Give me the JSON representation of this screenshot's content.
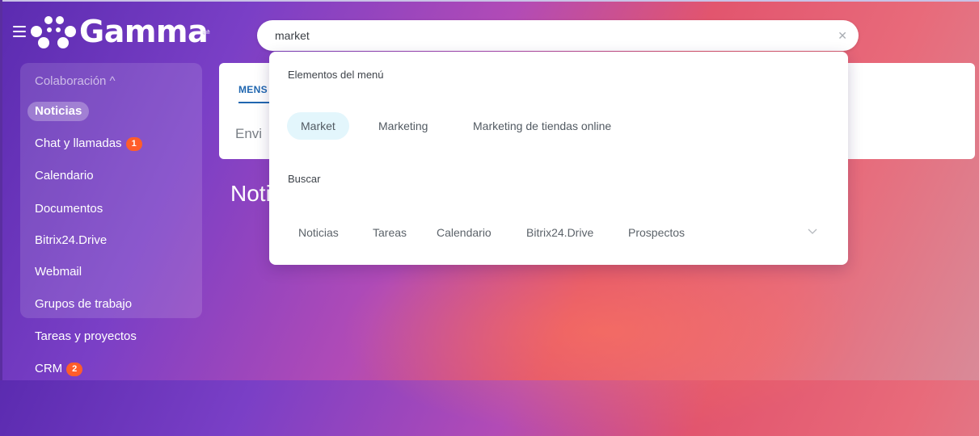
{
  "header": {
    "logo_text": "Gamma",
    "search": {
      "value": "market",
      "placeholder": ""
    }
  },
  "sidebar": {
    "section_header": "Colaboración ^",
    "items": [
      {
        "label": "Noticias",
        "active": true
      },
      {
        "label": "Chat y llamadas",
        "badge": "1"
      },
      {
        "label": "Calendario"
      },
      {
        "label": "Documentos"
      },
      {
        "label": "Bitrix24.Drive"
      },
      {
        "label": "Webmail"
      },
      {
        "label": "Grupos de trabajo"
      },
      {
        "label": "Tareas y proyectos"
      },
      {
        "label": "CRM",
        "badge": "2"
      }
    ]
  },
  "background_card": {
    "tab_label": "MENS",
    "input_text": "Envi"
  },
  "page_title": "Noti",
  "dropdown": {
    "menu_section_title": "Elementos del menú",
    "menu_items": [
      "Market",
      "Marketing",
      "Marketing de tiendas online"
    ],
    "search_section_title": "Buscar",
    "search_categories": [
      "Noticias",
      "Tareas",
      "Calendario",
      "Bitrix24.Drive",
      "Prospectos"
    ]
  },
  "colors": {
    "badge": "#ff5d2a",
    "chip_active_bg": "#e3f6fc",
    "tab_accent": "#2067b0"
  },
  "icons": [
    "menu-icon",
    "gamma-logo-icon",
    "swap-icon",
    "clear-search-icon",
    "chevron-down-icon"
  ]
}
